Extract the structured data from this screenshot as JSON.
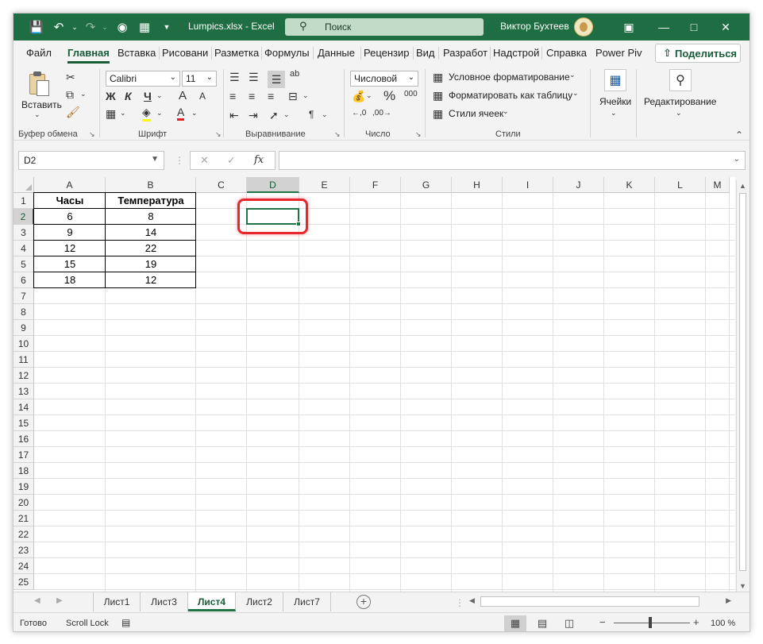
{
  "titlebar": {
    "title": "Lumpics.xlsx  -  Excel",
    "search_placeholder": "Поиск",
    "user": "Виктор Бухтеев"
  },
  "tabs": [
    "Файл",
    "Главная",
    "Вставка",
    "Рисовани",
    "Разметка",
    "Формулы",
    "Данные",
    "Рецензир",
    "Вид",
    "Разработ",
    "Надстрой",
    "Справка",
    "Power Piv"
  ],
  "active_tab": "Главная",
  "share_label": "Поделиться",
  "ribbon": {
    "clipboard": {
      "paste_label": "Вставить",
      "group_label": "Буфер обмена"
    },
    "font": {
      "font_name": "Calibri",
      "font_size": "11",
      "bold": "Ж",
      "italic": "К",
      "underline": "Ч",
      "grow": "A",
      "shrink": "A",
      "group_label": "Шрифт"
    },
    "alignment": {
      "group_label": "Выравнивание"
    },
    "number": {
      "format": "Числовой",
      "percent": "%",
      "thousands": "000",
      "group_label": "Число"
    },
    "styles": {
      "conditional": "Условное форматирование",
      "as_table": "Форматировать как таблицу",
      "cell_styles": "Стили ячеек",
      "group_label": "Стили"
    },
    "cells": {
      "label": "Ячейки"
    },
    "editing": {
      "label": "Редактирование"
    }
  },
  "formula_bar": {
    "name_box": "D2",
    "fx": "fx",
    "formula": ""
  },
  "grid": {
    "columns": [
      "A",
      "B",
      "C",
      "D",
      "E",
      "F",
      "G",
      "H",
      "I",
      "J",
      "K",
      "L",
      "M"
    ],
    "rows": [
      "1",
      "2",
      "3",
      "4",
      "5",
      "6",
      "7",
      "8",
      "9",
      "10",
      "11",
      "12",
      "13",
      "14",
      "15",
      "16",
      "17",
      "18",
      "19",
      "20",
      "21",
      "22",
      "23",
      "24",
      "25"
    ],
    "selected_cell": "D2",
    "table": {
      "headers": [
        "Часы",
        "Температура"
      ],
      "rows": [
        [
          "6",
          "8"
        ],
        [
          "9",
          "14"
        ],
        [
          "12",
          "22"
        ],
        [
          "15",
          "19"
        ],
        [
          "18",
          "12"
        ]
      ]
    }
  },
  "sheets": [
    "Лист1",
    "Лист3",
    "Лист4",
    "Лист2",
    "Лист7"
  ],
  "active_sheet": "Лист4",
  "status": {
    "ready": "Готово",
    "scroll_lock": "Scroll Lock",
    "zoom": "100 %"
  },
  "colors": {
    "excel_green": "#1f6e43",
    "accent": "#217346",
    "highlight_red": "#e8262d"
  }
}
